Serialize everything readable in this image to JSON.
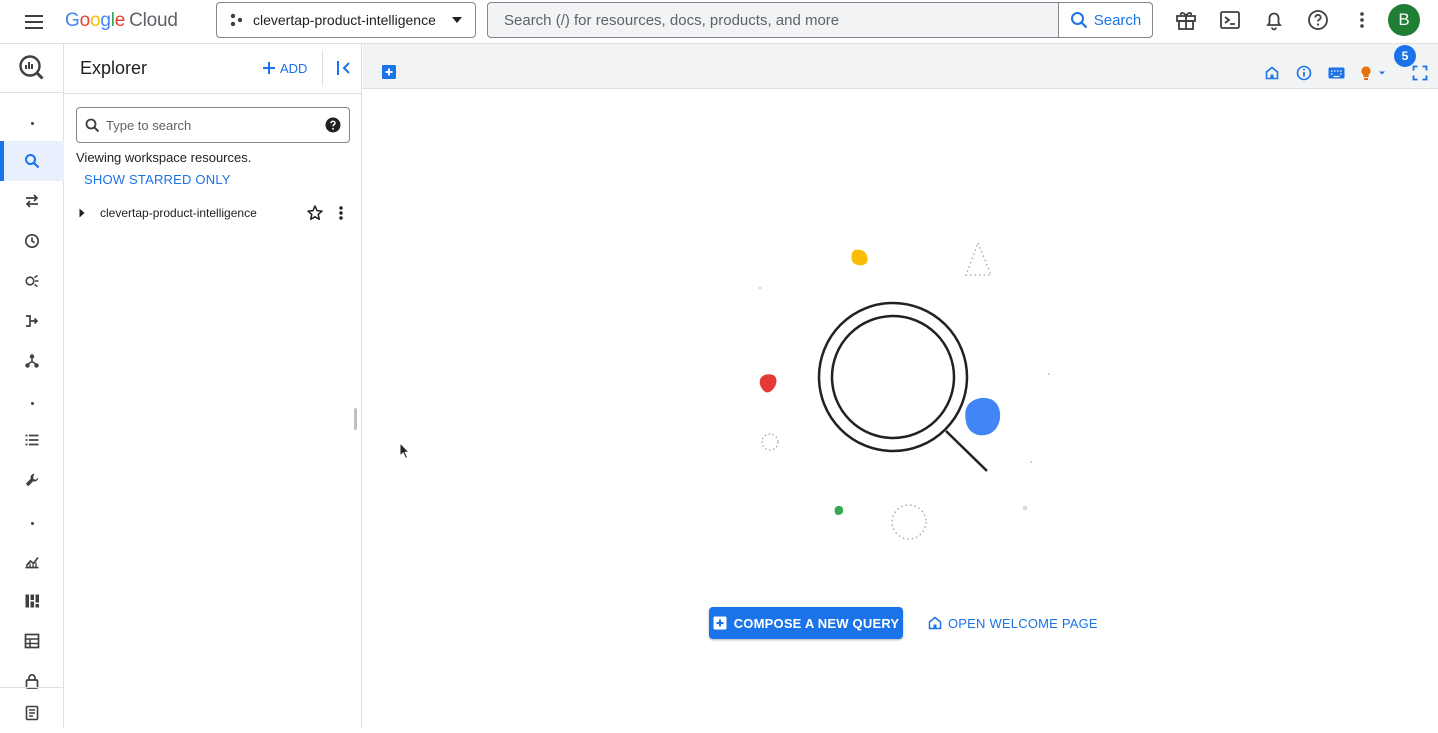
{
  "topbar": {
    "logo": {
      "google": "Google",
      "cloud": "Cloud"
    },
    "project_name": "clevertap-product-intelligence",
    "search": {
      "placeholder": "Search (/) for resources, docs, products, and more",
      "button_label": "Search"
    },
    "icons": [
      "gift-icon",
      "cloud-shell-icon",
      "notifications-icon",
      "help-icon",
      "more-vert-icon"
    ],
    "avatar_initial": "B",
    "avatar_color": "#1e7e34"
  },
  "rail": {
    "items": [
      "bigquery-logo-icon",
      "dot",
      "search-icon",
      "data-transfer-icon",
      "history-icon",
      "analytics-hub-icon",
      "dataflow-icon",
      "pipeline-icon",
      "dot",
      "list-icon",
      "wrench-icon",
      "dot",
      "chart-icon",
      "dashboard-icon",
      "table-icon",
      "lock-icon",
      "notes-icon"
    ]
  },
  "explorer": {
    "title": "Explorer",
    "add_label": "ADD",
    "search_placeholder": "Type to search",
    "viewing_text": "Viewing workspace resources.",
    "starred_label": "SHOW STARRED ONLY",
    "project_row_label": "clevertap-product-intelligence"
  },
  "main": {
    "notification_count": "5",
    "compose_label": "COMPOSE A NEW QUERY",
    "welcome_label": "OPEN WELCOME PAGE"
  },
  "colors": {
    "accent": "#1a73e8",
    "red": "#e53935",
    "yellow": "#fbbc04",
    "green": "#34a853",
    "blue": "#4285f4",
    "orange": "#e8710a"
  }
}
